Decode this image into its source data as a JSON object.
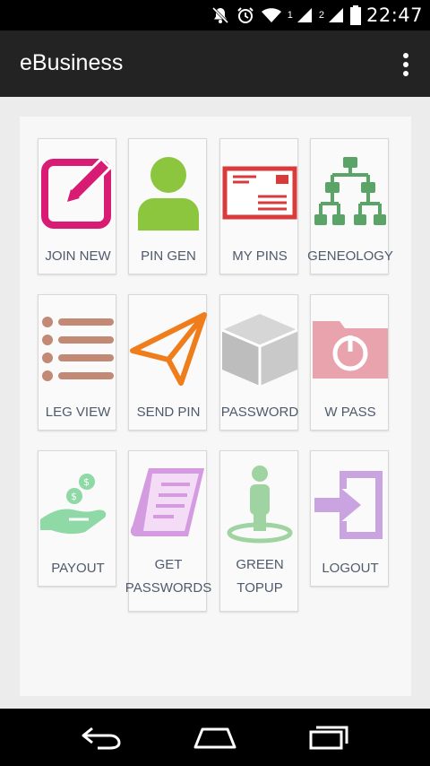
{
  "status_bar": {
    "time": "22:47",
    "sim1_label": "1",
    "sim2_label": "2",
    "icons": [
      "notification-muted-icon",
      "alarm-icon",
      "wifi-icon",
      "signal-sim1-icon",
      "signal-sim2-icon",
      "battery-icon"
    ]
  },
  "app_bar": {
    "title": "eBusiness",
    "overflow_icon": "more-vert-icon"
  },
  "grid": {
    "tiles": [
      {
        "label": "JOIN NEW",
        "icon": "edit-icon",
        "color": "#d81b73"
      },
      {
        "label": "PIN GEN",
        "icon": "user-icon",
        "color": "#8cc63f"
      },
      {
        "label": "MY PINS",
        "icon": "envelope-icon",
        "color": "#d93a3a"
      },
      {
        "label": "GENEOLOGY",
        "icon": "tree-icon",
        "color": "#5aa468"
      },
      {
        "label": "LEG VIEW",
        "icon": "list-icon",
        "color": "#c28a74"
      },
      {
        "label": "SEND PIN",
        "icon": "paper-plane-icon",
        "color": "#ef7d1c"
      },
      {
        "label": "PASSWORD",
        "icon": "box-icon",
        "color": "#bdbdbd"
      },
      {
        "label": "W PASS",
        "icon": "folder-power-icon",
        "color": "#e8a3ad"
      },
      {
        "label": "PAYOUT",
        "icon": "money-hand-icon",
        "color": "#8fd9a7"
      },
      {
        "label_line1": "GET",
        "label_line2": "PASSWORDS",
        "icon": "document-icon",
        "color": "#d59be0"
      },
      {
        "label_line1": "GREEN",
        "label_line2": "TOPUP",
        "icon": "person-location-icon",
        "color": "#9fd3a1"
      },
      {
        "label": "LOGOUT",
        "icon": "logout-icon",
        "color": "#c9a4e0"
      }
    ]
  },
  "nav_bar": {
    "buttons": [
      "back-icon",
      "home-icon",
      "recent-apps-icon"
    ]
  }
}
